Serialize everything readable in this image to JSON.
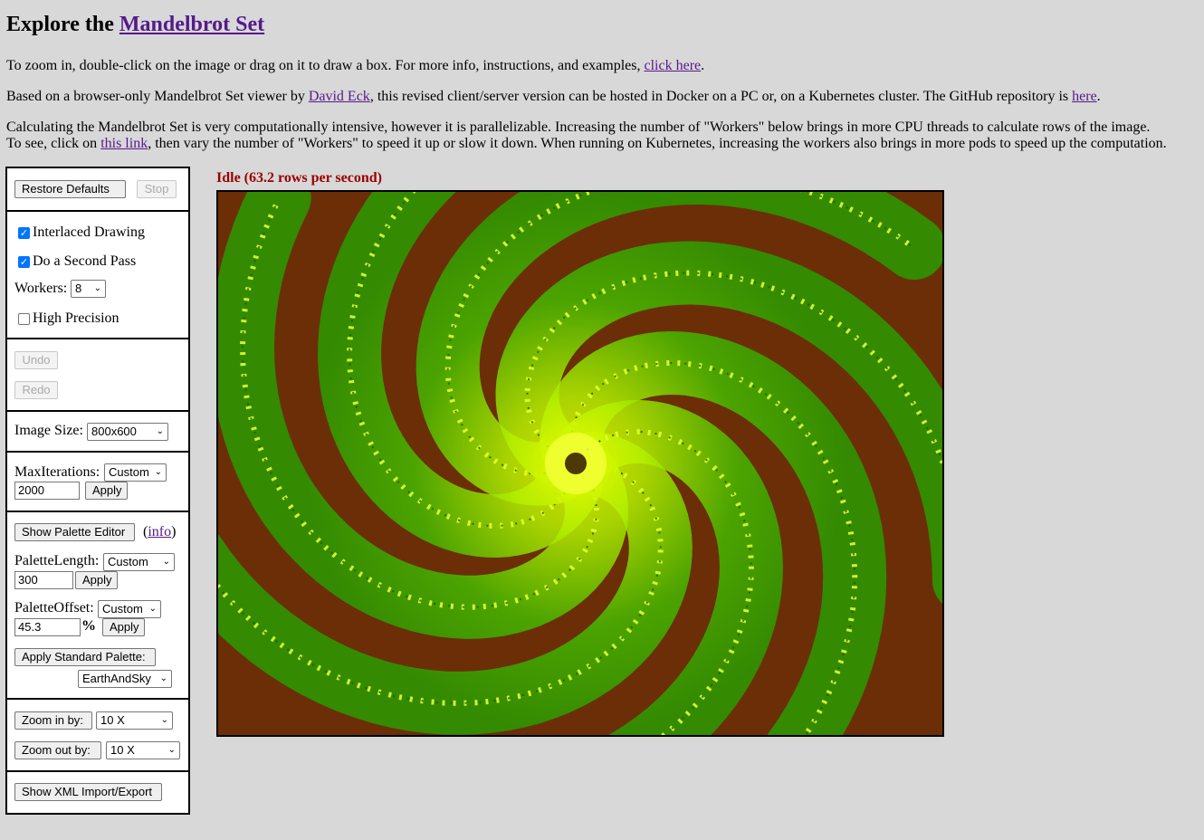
{
  "header": {
    "title_prefix": "Explore the",
    "title_link": "Mandelbrot Set"
  },
  "intro": {
    "p1_text": "To zoom in, double-click on the image or drag on it to draw a box. For more info, instructions, and examples,",
    "p1_link": "click here",
    "p1_end": ".",
    "p2_text1": "Based on a browser-only Mandelbrot Set viewer by",
    "p2_link1": "David Eck",
    "p2_text2": ", this revised client/server version can be hosted in Docker on a PC or, on a Kubernetes cluster. The GitHub repository is",
    "p2_link2": "here",
    "p2_end": ".",
    "p3_line1": "Calculating the Mandelbrot Set is very computationally intensive, however it is parallelizable. Increasing the number of \"Workers\" below brings in more CPU threads to calculate rows of the image.",
    "p3_line2_start": "To see, click on",
    "p3_link": "this link",
    "p3_line2_end": ", then vary the number of \"Workers\" to speed it up or slow it down. When running on Kubernetes, increasing the workers also brings in more pods to speed up the computation."
  },
  "controls": {
    "restore_defaults": "Restore Defaults",
    "stop": "Stop",
    "interlaced_label": "Interlaced Drawing",
    "interlaced_checked": true,
    "second_pass_label": "Do a Second Pass",
    "second_pass_checked": true,
    "workers_label": "Workers:",
    "workers_value": "8",
    "high_precision_label": "High Precision",
    "high_precision_checked": false,
    "undo": "Undo",
    "redo": "Redo",
    "image_size_label": "Image Size:",
    "image_size_value": "800x600",
    "max_iterations_label": "MaxIterations:",
    "max_iterations_select": "Custom",
    "max_iterations_value": "2000",
    "apply": "Apply",
    "show_palette_editor": "Show Palette Editor",
    "info_open": "(",
    "info_link": "info",
    "info_close": ")",
    "palette_length_label": "PaletteLength:",
    "palette_length_select": "Custom",
    "palette_length_value": "300",
    "palette_offset_label": "PaletteOffset:",
    "palette_offset_select": "Custom",
    "palette_offset_value": "45.3",
    "percent": "%",
    "apply_standard_palette": "Apply Standard Palette:",
    "standard_palette_value": "EarthAndSky",
    "zoom_in_label": "Zoom in by:",
    "zoom_in_value": "10 X",
    "zoom_out_label": "Zoom out by:",
    "zoom_out_value": "10 X",
    "show_xml": "Show XML Import/Export"
  },
  "status": {
    "text": "Idle (63.2 rows per second)"
  },
  "colors": {
    "background": "#d8d8d8",
    "status": "#990000",
    "link": "#551a8b",
    "fractal_outside": "#6b2e06",
    "fractal_green": "#2fa800",
    "fractal_yellow": "#e6ff00"
  },
  "checkmark_glyph": "✓",
  "chevron_glyph": "⌄"
}
